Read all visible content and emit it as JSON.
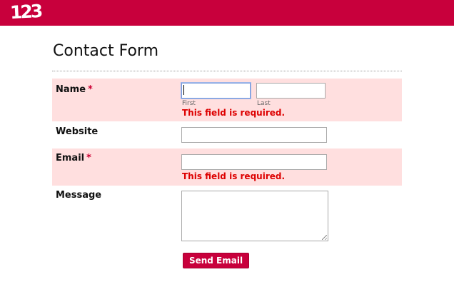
{
  "header": {
    "logo_text": "123",
    "brand_color": "#c8003c"
  },
  "form": {
    "title": "Contact Form",
    "error_bg_color": "#ffdfdf",
    "error_text_color": "#dd0000",
    "fields": {
      "name": {
        "label": "Name",
        "required_mark": "*",
        "first_sublabel": "First",
        "last_sublabel": "Last",
        "first_value": "",
        "last_value": "",
        "error": "This field is required."
      },
      "website": {
        "label": "Website",
        "value": ""
      },
      "email": {
        "label": "Email",
        "required_mark": "*",
        "value": "",
        "error": "This field is required."
      },
      "message": {
        "label": "Message",
        "value": ""
      }
    },
    "submit_label": "Send Email"
  }
}
